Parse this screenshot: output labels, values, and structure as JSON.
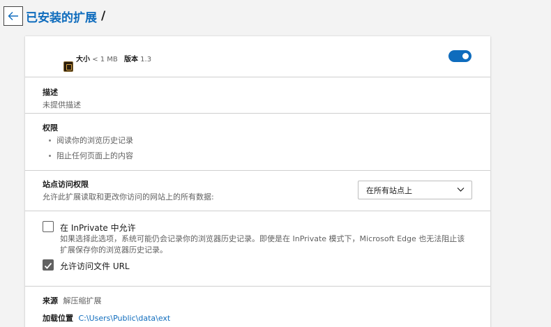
{
  "header": {
    "back_icon": "arrow-left-icon",
    "breadcrumb": "已安装的扩展",
    "separator": "/"
  },
  "extension": {
    "size_label": "大小",
    "size_value": "< 1 MB",
    "version_label": "版本",
    "version_value": "1.3",
    "enabled": true
  },
  "description": {
    "title": "描述",
    "text": "未提供描述"
  },
  "permissions": {
    "title": "权限",
    "items": [
      "阅读你的浏览历史记录",
      "阻止任何页面上的内容"
    ]
  },
  "site_access": {
    "title": "站点访问权限",
    "text": "允许此扩展读取和更改你访问的网站上的所有数据:",
    "selected": "在所有站点上"
  },
  "inprivate": {
    "label": "在 InPrivate 中允许",
    "checked": false,
    "description": "如果选择此选项，系统可能仍会记录你的浏览器历史记录。即使是在 InPrivate 模式下，Microsoft Edge 也无法阻止该扩展保存你的浏览器历史记录。"
  },
  "file_url": {
    "label": "允许访问文件 URL",
    "checked": true
  },
  "source": {
    "source_label": "来源",
    "source_value": "解压缩扩展",
    "location_label": "加载位置",
    "location_value": "C:\\Users\\Public\\data\\ext"
  },
  "colors": {
    "accent": "#0f6cbd",
    "background": "#f3f3f3",
    "card": "#ffffff",
    "muted_text": "#616161"
  }
}
